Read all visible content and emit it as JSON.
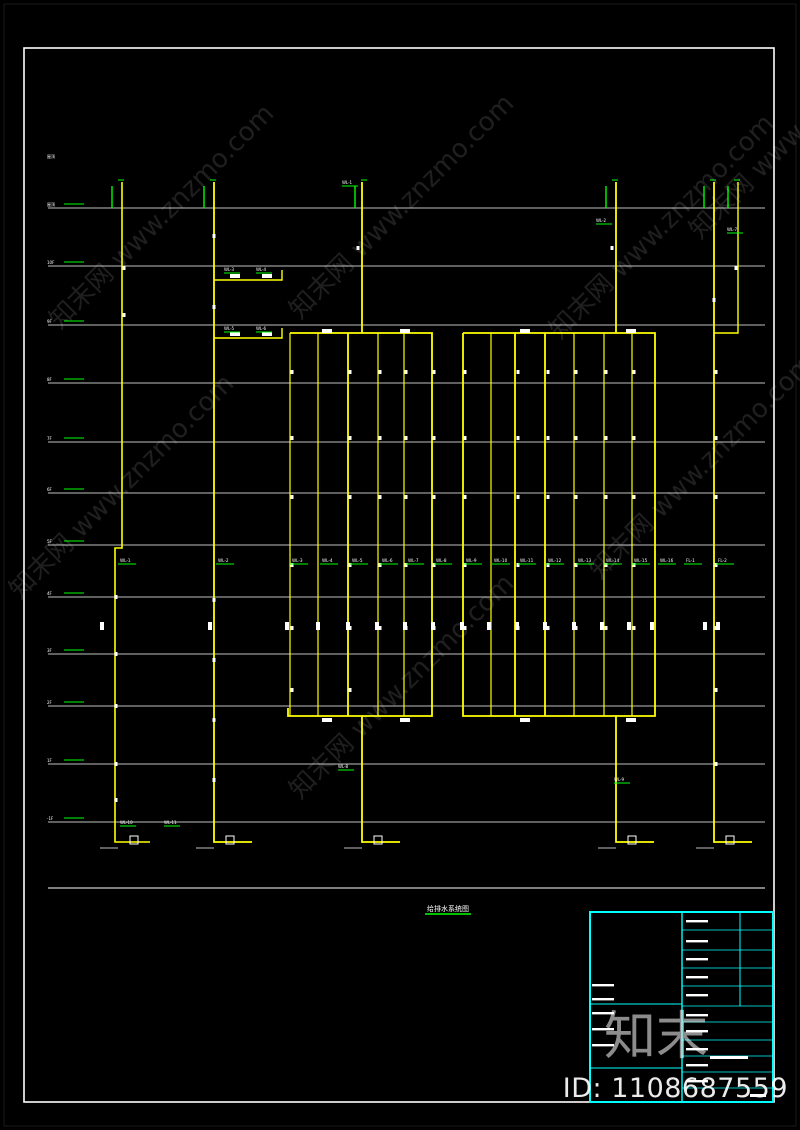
{
  "drawing": {
    "title": "给排水系统图",
    "colors": {
      "background": "#000000",
      "frame": "#ffffff",
      "pipe": "#ffff00",
      "label": "#00ff00",
      "titleblock": "#00ffff",
      "text": "#ffffff"
    },
    "floor_levels": [
      "屋顶",
      "10F",
      "9F",
      "8F",
      "7F",
      "6F",
      "5F",
      "4F",
      "3F",
      "2F",
      "1F",
      "-1F"
    ],
    "riser_tags": [
      "WL-1",
      "WL-2",
      "WL-3",
      "WL-4",
      "WL-5",
      "WL-6",
      "WL-7",
      "WL-8",
      "WL-9",
      "WL-10",
      "WL-11",
      "WL-12",
      "WL-13",
      "WL-14",
      "WL-15",
      "WL-16",
      "FL-1",
      "FL-2"
    ]
  },
  "watermark": {
    "site": "www.znzmo.com",
    "brand": "知末网",
    "logo": "知末",
    "id_text": "ID: 1108687559"
  }
}
